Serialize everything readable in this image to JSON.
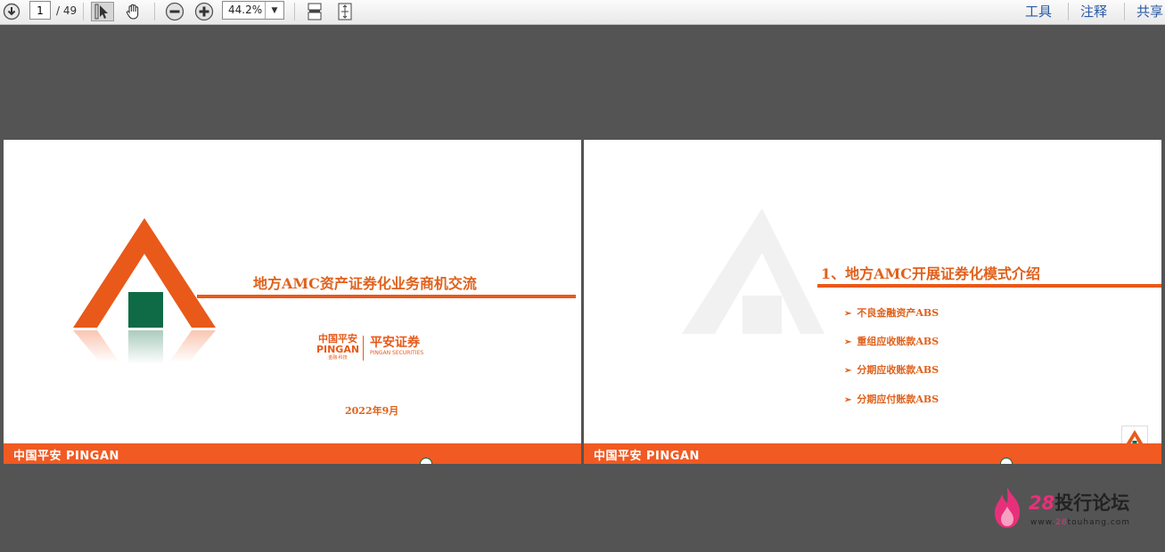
{
  "toolbar": {
    "current_page": "1",
    "page_total": "/ 49",
    "zoom": "44.2%",
    "tools_label": "工具",
    "annotate_label": "注释",
    "share_label": "共享"
  },
  "slide1": {
    "title": "地方AMC资产证券化业务商机交流",
    "logo_cn_main": "中国平安",
    "logo_en_main": "PINGAN",
    "logo_tagline": "金融·科技",
    "logo_sec_cn": "平安证券",
    "logo_sec_en": "PINGAN SECURITIES",
    "date": "2022年9月",
    "footer": "中国平安 PINGAN"
  },
  "slide2": {
    "heading": "1、地方AMC开展证券化模式介绍",
    "bullets": [
      "不良金融资产ABS",
      "重组应收账款ABS",
      "分期应收账款ABS",
      "分期应付账款ABS"
    ],
    "footer": "中国平安 PINGAN"
  },
  "watermark": {
    "number": "28",
    "text": "投行论坛",
    "url_prefix": "www.",
    "url_highlight": "28",
    "url_suffix": "touhang.com"
  },
  "colors": {
    "brand_orange": "#f15a22",
    "title_orange": "#e0611c",
    "brand_green": "#0e6b45",
    "toolbar_link": "#2a5aa5"
  }
}
